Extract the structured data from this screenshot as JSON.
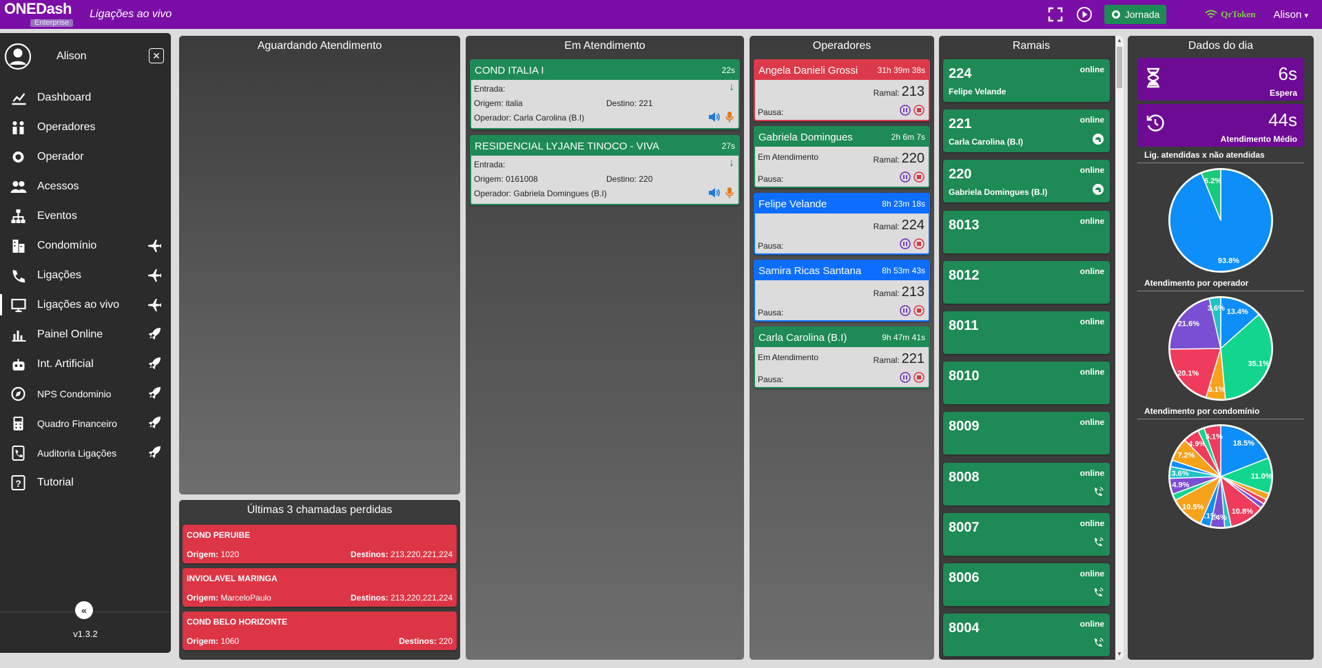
{
  "topbar": {
    "logo": "ONEDash",
    "logo_sub": "Enterprise",
    "page_title": "Ligações ao vivo",
    "jornada_label": "Jornada",
    "qrtoken_label": "QrToken",
    "user_label": "Alison"
  },
  "sidebar": {
    "user_name": "Alison",
    "version": "v1.3.2",
    "items": [
      {
        "label": "Dashboard",
        "icon": "chart-icon"
      },
      {
        "label": "Operadores",
        "icon": "users-icon"
      },
      {
        "label": "Operador",
        "icon": "headset-icon"
      },
      {
        "label": "Acessos",
        "icon": "group-icon"
      },
      {
        "label": "Eventos",
        "icon": "sitemap-icon"
      },
      {
        "label": "Condomínio",
        "icon": "building-icon"
      },
      {
        "label": "Ligações",
        "icon": "phone-icon"
      },
      {
        "label": "Ligações ao vivo",
        "icon": "monitor-icon"
      },
      {
        "label": "Painel Online",
        "icon": "bar-chart-icon"
      },
      {
        "label": "Int. Artificial",
        "icon": "robot-icon"
      },
      {
        "label": "NPS Condominio",
        "icon": "compass-icon"
      },
      {
        "label": "Quadro Financeiro",
        "icon": "calculator-icon"
      },
      {
        "label": "Auditoria Ligações",
        "icon": "phone-book-icon"
      },
      {
        "label": "Tutorial",
        "icon": "question-icon"
      }
    ]
  },
  "aguardando": {
    "title": "Aguardando Atendimento"
  },
  "perdidas": {
    "title": "Últimas 3 chamadas perdidas",
    "origem_label": "Origem:",
    "destinos_label": "Destinos:",
    "items": [
      {
        "name": "COND PERUIBE",
        "origem": "1020",
        "destinos": "213,220,221,224"
      },
      {
        "name": "INVIOLAVEL MARINGA",
        "origem": "MarceloPaulo",
        "destinos": "213,220,221,224"
      },
      {
        "name": "COND BELO HORIZONTE",
        "origem": "1060",
        "destinos": "220"
      }
    ]
  },
  "em_atendimento": {
    "title": "Em Atendimento",
    "entrada_label": "Entrada:",
    "calls": [
      {
        "name": "COND ITALIA I",
        "time": "22s",
        "origem": "Origem: italia",
        "destino": "Destino: 221",
        "operador": "Operador: Carla Carolina (B.I)"
      },
      {
        "name": "RESIDENCIAL LYJANE TINOCO - VIVA",
        "time": "27s",
        "origem": "Origem: 0161008",
        "destino": "Destino: 220",
        "operador": "Operador: Gabriela Domingues (B.I)"
      }
    ]
  },
  "operadores": {
    "title": "Operadores",
    "ramal_label": "Ramal:",
    "pausa_label": "Pausa:",
    "items": [
      {
        "name": "Angela Danieli Grossi",
        "time": "31h 39m 38s",
        "status": "",
        "ramal": "213",
        "color": "#dc3a4a"
      },
      {
        "name": "Gabriela Domingues",
        "time": "2h 6m 7s",
        "status": "Em Atendimento",
        "ramal": "220",
        "color": "#1e8a55"
      },
      {
        "name": "Felipe Velande",
        "time": "8h 23m 18s",
        "status": "",
        "ramal": "224",
        "color": "#0d6efd"
      },
      {
        "name": "Samira Ricas Santana",
        "time": "8h 53m 43s",
        "status": "",
        "ramal": "213",
        "color": "#0d6efd"
      },
      {
        "name": "Carla Carolina (B.I)",
        "time": "9h 47m 41s",
        "status": "Em Atendimento",
        "ramal": "221",
        "color": "#1e8a55"
      }
    ]
  },
  "ramais": {
    "title": "Ramais",
    "items": [
      {
        "num": "224",
        "status": "online",
        "name": "Felipe Velande",
        "icon": ""
      },
      {
        "num": "221",
        "status": "online",
        "name": "Carla Carolina (B.I)",
        "icon": "headset-icon"
      },
      {
        "num": "220",
        "status": "online",
        "name": "Gabriela Domingues (B.I)",
        "icon": "headset-icon"
      },
      {
        "num": "8013",
        "status": "online",
        "name": "",
        "icon": ""
      },
      {
        "num": "8012",
        "status": "online",
        "name": "",
        "icon": ""
      },
      {
        "num": "8011",
        "status": "online",
        "name": "",
        "icon": ""
      },
      {
        "num": "8010",
        "status": "online",
        "name": "",
        "icon": ""
      },
      {
        "num": "8009",
        "status": "online",
        "name": "",
        "icon": ""
      },
      {
        "num": "8008",
        "status": "online",
        "name": "",
        "icon": "phone-volume-icon"
      },
      {
        "num": "8007",
        "status": "online",
        "name": "",
        "icon": "phone-volume-icon"
      },
      {
        "num": "8006",
        "status": "online",
        "name": "",
        "icon": "phone-volume-icon"
      },
      {
        "num": "8004",
        "status": "online",
        "name": "",
        "icon": "phone-volume-icon"
      }
    ]
  },
  "dados_dia": {
    "title": "Dados do dia",
    "espera_value": "6s",
    "espera_label": "Espera",
    "media_value": "44s",
    "media_label": "Atendimento Médio",
    "sec1": "Lig. atendidas x não atendidas",
    "sec2": "Atendimento por operador",
    "sec3": "Atendimento por condomínio"
  },
  "chart_data": [
    {
      "type": "pie",
      "title": "Lig. atendidas x não atendidas",
      "values": [
        93.8,
        6.2
      ],
      "labels": [
        "93.8%",
        "6.2%"
      ],
      "colors": [
        "#0d8ef8",
        "#19c97a"
      ]
    },
    {
      "type": "pie",
      "title": "Atendimento por operador",
      "values": [
        13.4,
        35.1,
        6.1,
        20.1,
        21.6,
        3.6
      ],
      "labels": [
        "13.4%",
        "35.1%",
        "6.1%",
        "20.1%",
        "21.6%",
        "3.6%"
      ],
      "colors": [
        "#0d8ef8",
        "#12d68e",
        "#f7a21b",
        "#ef3b5c",
        "#7b4fd4",
        "#1ec3c3"
      ]
    },
    {
      "type": "pie",
      "title": "Atendimento por condomínio",
      "values": [
        18.5,
        11.0,
        2.0,
        1.5,
        1.5,
        10.8,
        2.0,
        4.4,
        3.1,
        10.5,
        2.0,
        4.9,
        3.6,
        2.0,
        7.2,
        4.9,
        2.0,
        5.1
      ],
      "labels": [
        "18.5%",
        "11.0%",
        "",
        "",
        "",
        "10.8%",
        "",
        "4.4%",
        "3.1%",
        "10.5%",
        "",
        "4.9%",
        "3.6%",
        "",
        "7.2%",
        "4.9%",
        "",
        "5.1%"
      ],
      "colors": [
        "#0d8ef8",
        "#12d68e",
        "#f7a21b",
        "#ef3b5c",
        "#7b4fd4",
        "#ef3b5c",
        "#1ec3c3",
        "#7b4fd4",
        "#0d8ef8",
        "#f7a21b",
        "#12d68e",
        "#7b4fd4",
        "#1ec3c3",
        "#0d8ef8",
        "#f7a21b",
        "#ef3b5c",
        "#12d68e",
        "#ef3b5c"
      ]
    }
  ]
}
